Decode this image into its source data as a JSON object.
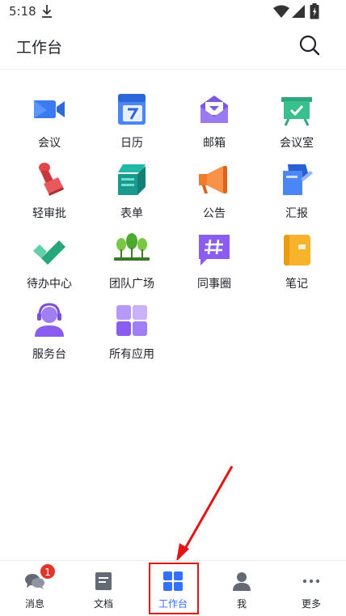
{
  "status_bar": {
    "time": "5:18"
  },
  "header": {
    "title": "工作台"
  },
  "apps": [
    {
      "label": "会议",
      "icon": "video-meeting-icon"
    },
    {
      "label": "日历",
      "icon": "calendar-icon"
    },
    {
      "label": "邮箱",
      "icon": "mail-icon"
    },
    {
      "label": "会议室",
      "icon": "meeting-room-icon"
    },
    {
      "label": "轻审批",
      "icon": "stamp-icon"
    },
    {
      "label": "表单",
      "icon": "form-icon"
    },
    {
      "label": "公告",
      "icon": "megaphone-icon"
    },
    {
      "label": "汇报",
      "icon": "report-icon"
    },
    {
      "label": "待办中心",
      "icon": "checkmark-icon"
    },
    {
      "label": "团队广场",
      "icon": "team-square-icon"
    },
    {
      "label": "同事圈",
      "icon": "hashtag-chat-icon"
    },
    {
      "label": "笔记",
      "icon": "notebook-icon"
    },
    {
      "label": "服务台",
      "icon": "headset-agent-icon"
    },
    {
      "label": "所有应用",
      "icon": "all-apps-icon"
    }
  ],
  "tabs": [
    {
      "label": "消息",
      "icon": "chat-bubbles-icon",
      "badge": "1"
    },
    {
      "label": "文档",
      "icon": "document-icon"
    },
    {
      "label": "工作台",
      "icon": "grid-icon",
      "active": true
    },
    {
      "label": "我",
      "icon": "person-icon"
    },
    {
      "label": "更多",
      "icon": "more-dots-icon"
    }
  ],
  "colors": {
    "accent": "#3370ff",
    "annotation": "#e41414",
    "badge": "#e0352b"
  }
}
